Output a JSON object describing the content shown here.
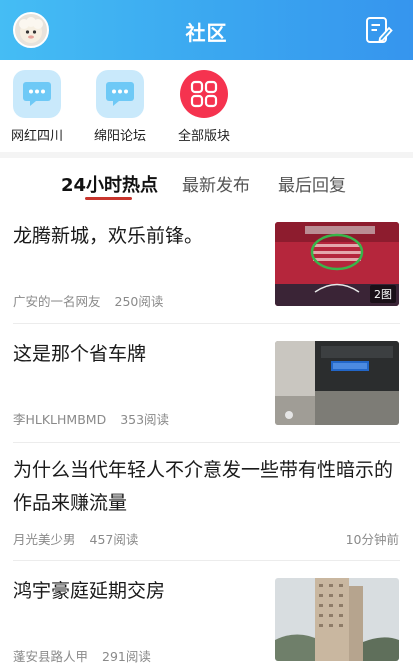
{
  "header": {
    "title": "社区"
  },
  "shortcuts": [
    {
      "label": "网红四川",
      "icon": "chat-bubble-icon"
    },
    {
      "label": "绵阳论坛",
      "icon": "chat-bubble-icon"
    },
    {
      "label": "全部版块",
      "icon": "grid-icon"
    }
  ],
  "tabs": [
    {
      "label": "24小时热点",
      "active": true
    },
    {
      "label": "最新发布",
      "active": false
    },
    {
      "label": "最后回复",
      "active": false
    }
  ],
  "posts": [
    {
      "title": "龙腾新城，欢乐前锋。",
      "author": "广安的一名网友",
      "reads": "250阅读",
      "image_count": "2图"
    },
    {
      "title": "这是那个省车牌",
      "author": "李HLKLHMBMD",
      "reads": "353阅读"
    },
    {
      "title": "为什么当代年轻人不介意发一些带有性暗示的作品来赚流量",
      "author": "月光美少男",
      "reads": "457阅读",
      "time": "10分钟前"
    },
    {
      "title": "鸿宇豪庭延期交房",
      "author": "蓬安县路人甲",
      "reads": "291阅读"
    }
  ],
  "colors": {
    "header_blue": "#3aa6f0",
    "accent_red": "#f5334f",
    "tab_underline": "#c7342c"
  }
}
